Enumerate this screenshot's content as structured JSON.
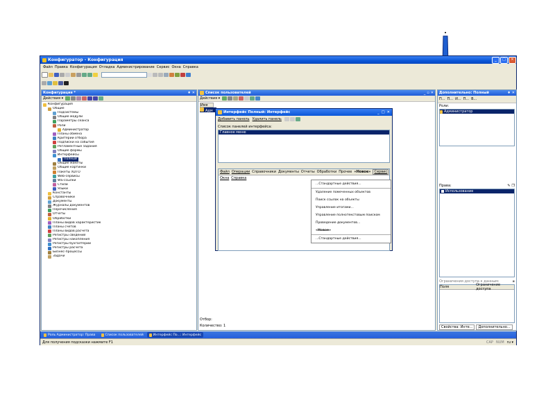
{
  "app": {
    "title": "Конфигуратор - Конфигурация",
    "menu": [
      "Файл",
      "Правка",
      "Конфигурация",
      "Отладка",
      "Администрирование",
      "Сервис",
      "Окна",
      "Справка"
    ]
  },
  "config_panel": {
    "title": "Конфигурация *",
    "actions": "Действия ▾",
    "tree": [
      {
        "label": "Конфигурация",
        "level": 0,
        "icon": "config-icon"
      },
      {
        "label": "Общие",
        "level": 1,
        "icon": "folder-icon"
      },
      {
        "label": "Подсистемы",
        "level": 2,
        "icon": "subsystem-icon"
      },
      {
        "label": "Общие модули",
        "level": 2,
        "icon": "module-icon"
      },
      {
        "label": "Параметры сеанса",
        "level": 2,
        "icon": "param-icon"
      },
      {
        "label": "Роли",
        "level": 2,
        "icon": "role-icon"
      },
      {
        "label": "Администратор",
        "level": 3,
        "icon": "role-item-icon"
      },
      {
        "label": "Планы обмена",
        "level": 2,
        "icon": "exchange-icon"
      },
      {
        "label": "Критерии отбора",
        "level": 2,
        "icon": "filter-icon"
      },
      {
        "label": "Подписки на события",
        "level": 2,
        "icon": "event-icon"
      },
      {
        "label": "Регламентные задания",
        "level": 2,
        "icon": "schedule-icon"
      },
      {
        "label": "Общие формы",
        "level": 2,
        "icon": "form-icon"
      },
      {
        "label": "Интерфейсы",
        "level": 2,
        "icon": "interface-icon"
      },
      {
        "label": "Полный",
        "level": 3,
        "icon": "interface-item-icon",
        "selected": true
      },
      {
        "label": "Общие макеты",
        "level": 2,
        "icon": "layout-icon"
      },
      {
        "label": "Общие картинки",
        "level": 2,
        "icon": "picture-icon"
      },
      {
        "label": "Пакеты XDTO",
        "level": 2,
        "icon": "xdto-icon"
      },
      {
        "label": "Web-сервисы",
        "level": 2,
        "icon": "web-icon"
      },
      {
        "label": "WS-ссылки",
        "level": 2,
        "icon": "ws-icon"
      },
      {
        "label": "Стили",
        "level": 2,
        "icon": "style-icon"
      },
      {
        "label": "Языки",
        "level": 2,
        "icon": "lang-icon"
      },
      {
        "label": "Константы",
        "level": 1,
        "icon": "const-icon"
      },
      {
        "label": "Справочники",
        "level": 1,
        "icon": "catalog-icon"
      },
      {
        "label": "Документы",
        "level": 1,
        "icon": "doc-icon"
      },
      {
        "label": "Журналы документов",
        "level": 1,
        "icon": "journal-icon"
      },
      {
        "label": "Перечисления",
        "level": 1,
        "icon": "enum-icon"
      },
      {
        "label": "Отчеты",
        "level": 1,
        "icon": "report-icon"
      },
      {
        "label": "Обработки",
        "level": 1,
        "icon": "processing-icon"
      },
      {
        "label": "Планы видов характеристик",
        "level": 1,
        "icon": "chart-types-icon"
      },
      {
        "label": "Планы счетов",
        "level": 1,
        "icon": "accounts-icon"
      },
      {
        "label": "Планы видов расчета",
        "level": 1,
        "icon": "calc-types-icon"
      },
      {
        "label": "Регистры сведений",
        "level": 1,
        "icon": "info-reg-icon"
      },
      {
        "label": "Регистры накопления",
        "level": 1,
        "icon": "accum-reg-icon"
      },
      {
        "label": "Регистры бухгалтерии",
        "level": 1,
        "icon": "acc-reg-icon"
      },
      {
        "label": "Регистры расчета",
        "level": 1,
        "icon": "calc-reg-icon"
      },
      {
        "label": "Бизнес-процессы",
        "level": 1,
        "icon": "bp-icon"
      },
      {
        "label": "Задачи",
        "level": 1,
        "icon": "task-icon"
      }
    ]
  },
  "users_panel": {
    "title": "Список пользователей",
    "actions": "Действия ▾",
    "column": "Имя",
    "first_row": "Адм",
    "filter": "Отбор:",
    "count": "Количество: 1"
  },
  "interface_window": {
    "title": "Интерфейс Полный: Интерфейс",
    "add_panel": "Добавить панель",
    "delete_panel": "Удалить панель",
    "list_label": "Список панелей интерфейса:",
    "list_items": [
      "Главное меню"
    ],
    "menu": [
      "Файл",
      "Операции",
      "Справочники",
      "Документы",
      "Отчеты",
      "Обработки",
      "Прочее",
      "«Новое»",
      "Сервис"
    ],
    "submenu": [
      "Окна",
      "Справка"
    ],
    "dropdown": [
      "...Стандартные действия...",
      "Удаление помеченных объектов",
      "Поиск ссылок на объекты",
      "Управление итогами...",
      "Управление полнотекстовым поиском",
      "Проведение документов...",
      "«Новое»",
      "...Стандартные действия..."
    ]
  },
  "right_panel": {
    "title": "Дополнительно: Полный",
    "tabs": [
      "П...",
      "П...",
      "И...",
      "П...",
      "В..."
    ],
    "roles_label": "Роли:",
    "roles": [
      "Администратор"
    ],
    "rights_label": "Права:",
    "rights": [
      "Использование"
    ],
    "restrictions_label": "Ограничения доступа к данным:",
    "col_field": "Поля",
    "col_restriction": "Ограничение доступа",
    "bottom_tabs": [
      "Свойства: Инте...",
      "Дополнительно..."
    ]
  },
  "taskbar": [
    "Роль Администратор: Права",
    "Список пользователей",
    "Интерфейс По...: Интерфейс"
  ],
  "status": {
    "hint": "Для получения подсказки нажмите F1",
    "caps": "CAP",
    "num": "NUM",
    "lang": "ru ▾"
  },
  "colors": {
    "title_blue": "#0a56d8",
    "selection": "#0a246a",
    "panel_bg": "#ece9d8"
  }
}
